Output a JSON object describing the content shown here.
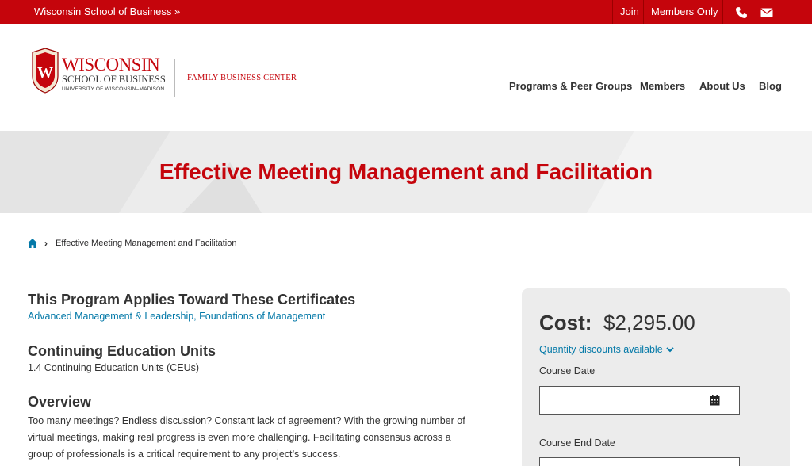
{
  "topbar": {
    "site_link": "Wisconsin School of Business »",
    "join": "Join",
    "members_only": "Members Only",
    "icons": [
      "phone-icon",
      "envelope-icon"
    ]
  },
  "header": {
    "logo": {
      "wisconsin": "WISCONSIN",
      "school": "SCHOOL OF BUSINESS",
      "university": "UNIVERSITY OF WISCONSIN–MADISON"
    },
    "center_name": "FAMILY BUSINESS CENTER",
    "nav": [
      "Programs & Peer Groups",
      "Members",
      "About Us",
      "Blog"
    ]
  },
  "hero": {
    "title": "Effective Meeting Management and Facilitation"
  },
  "breadcrumb": {
    "current": "Effective Meeting Management and Facilitation"
  },
  "main": {
    "certificates": {
      "heading": "This Program Applies Toward These Certificates",
      "links": "Advanced Management & Leadership, Foundations of Management"
    },
    "ceu": {
      "heading": "Continuing Education Units",
      "value": "1.4 Continuing Education Units (CEUs)"
    },
    "overview": {
      "heading": "Overview",
      "text": "Too many meetings? Endless discussion? Constant lack of agreement? With the growing number of virtual meetings, making real progress is even more challenging. Facilitating consensus across a group of professionals is a critical requirement to any project’s success."
    }
  },
  "sidebar": {
    "cost_label": "Cost:",
    "cost_value": "$2,295.00",
    "discount_link": "Quantity discounts available",
    "course_date_label": "Course Date",
    "course_date_value": "",
    "course_end_date_label": "Course End Date",
    "course_end_date_value": ""
  },
  "colors": {
    "brand_red": "#c5050c",
    "link_blue": "#0479a8",
    "hero_bg": "#ececec"
  }
}
